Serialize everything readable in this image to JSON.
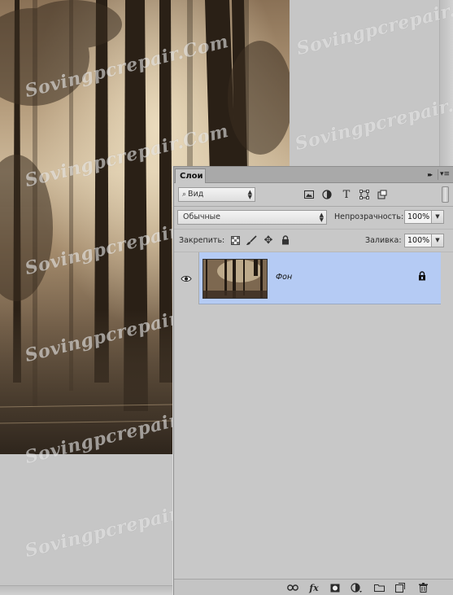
{
  "panel": {
    "tab_title": "Слои",
    "collapse_glyph": "▸▸",
    "menu_glyph": "▾≡"
  },
  "filter": {
    "kind_label": "Вид",
    "icons": [
      "image-filter-icon",
      "adjustment-filter-icon",
      "type-filter-icon",
      "shape-filter-icon",
      "smart-object-filter-icon"
    ]
  },
  "blend": {
    "mode_value": "Обычные",
    "opacity_label": "Непрозрачность:",
    "opacity_value": "100%"
  },
  "locks": {
    "label": "Закрепить:",
    "icons": [
      "lock-transparent-pixels-icon",
      "lock-image-pixels-icon",
      "lock-position-icon",
      "lock-all-icon"
    ],
    "fill_label": "Заливка:",
    "fill_value": "100%"
  },
  "layers": [
    {
      "name": "Фон",
      "visible": true,
      "locked": true,
      "selected": true
    }
  ],
  "footer_icons": [
    "link-layers-icon",
    "layer-style-icon",
    "add-mask-icon",
    "new-adjustment-layer-icon",
    "new-group-icon",
    "new-layer-icon",
    "delete-layer-icon"
  ],
  "watermark_text": "Sovingpcrepair.Com",
  "colors": {
    "selection": "#b5cbf4",
    "panel_bg": "#c8c8c8",
    "titlebar": "#a9a9a9"
  }
}
